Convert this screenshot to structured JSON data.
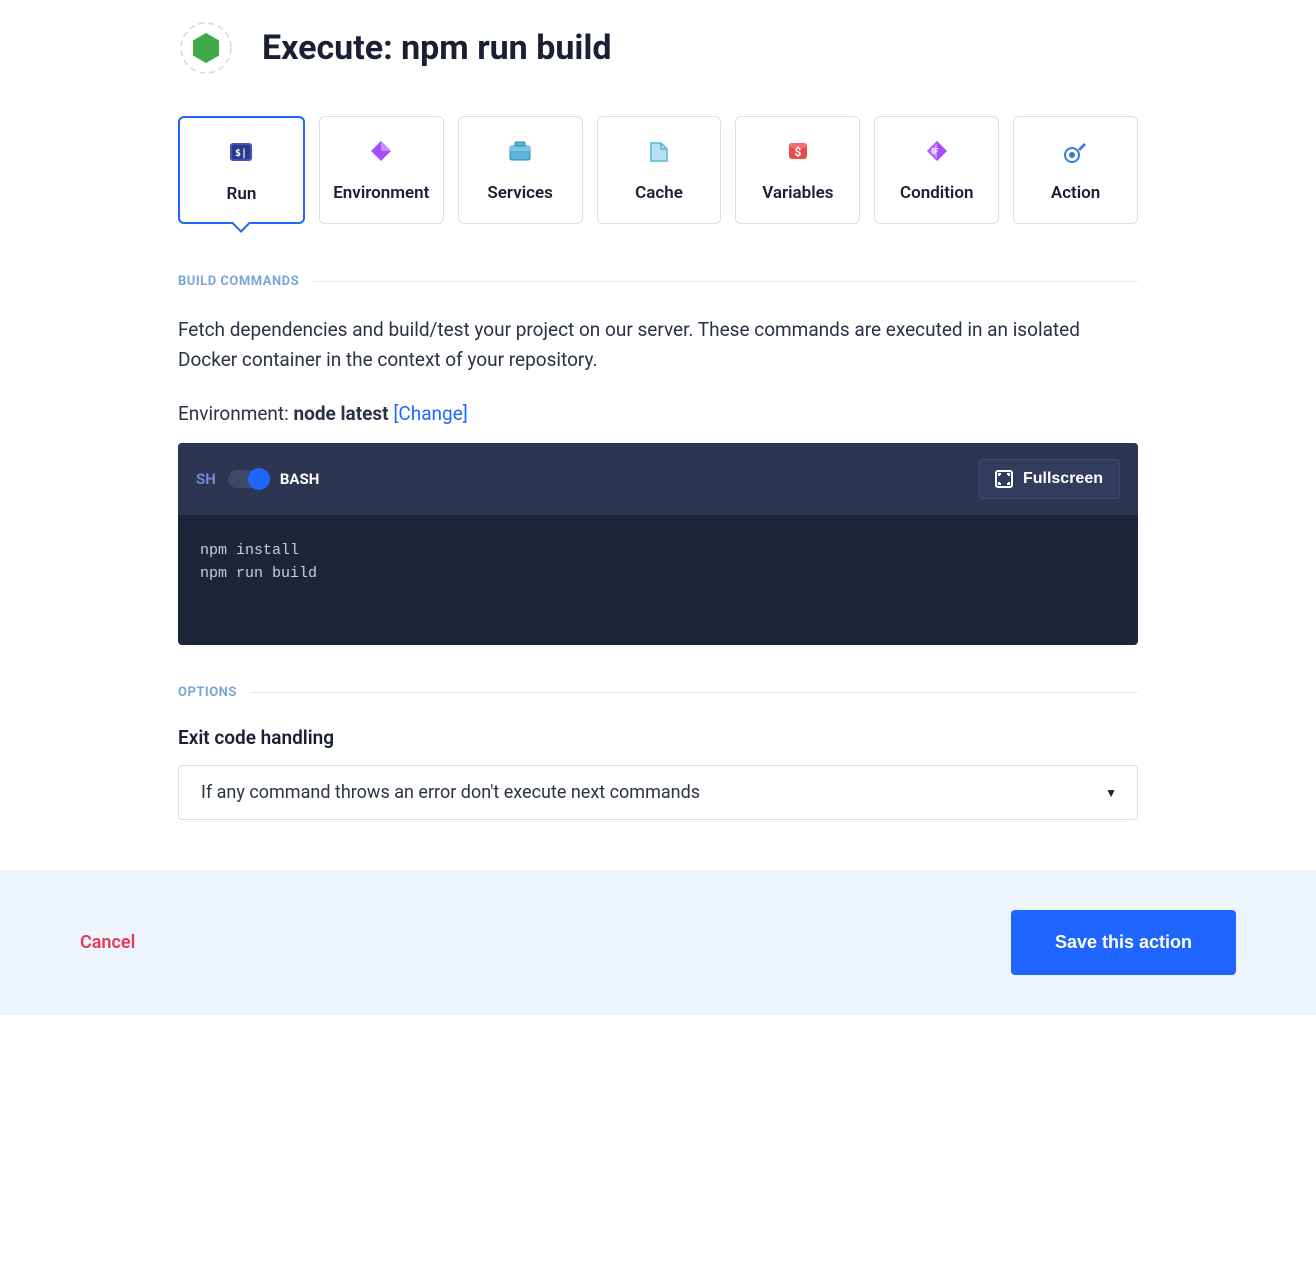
{
  "header": {
    "title": "Execute: npm run build"
  },
  "tabs": [
    {
      "label": "Run"
    },
    {
      "label": "Environment"
    },
    {
      "label": "Services"
    },
    {
      "label": "Cache"
    },
    {
      "label": "Variables"
    },
    {
      "label": "Condition"
    },
    {
      "label": "Action"
    }
  ],
  "build": {
    "section": "BUILD COMMANDS",
    "desc": "Fetch dependencies and build/test your project on our server. These commands are executed in an isolated Docker container in the context of your repository.",
    "env_prefix": "Environment: ",
    "env_value": "node latest",
    "change": "[Change]"
  },
  "editor": {
    "sh": "SH",
    "bash": "BASH",
    "fullscreen": "Fullscreen",
    "code": "npm install\nnpm run build"
  },
  "options": {
    "section": "OPTIONS",
    "exit_label": "Exit code handling",
    "exit_value": "If any command throws an error don't execute next commands"
  },
  "footer": {
    "cancel": "Cancel",
    "save": "Save this action"
  }
}
